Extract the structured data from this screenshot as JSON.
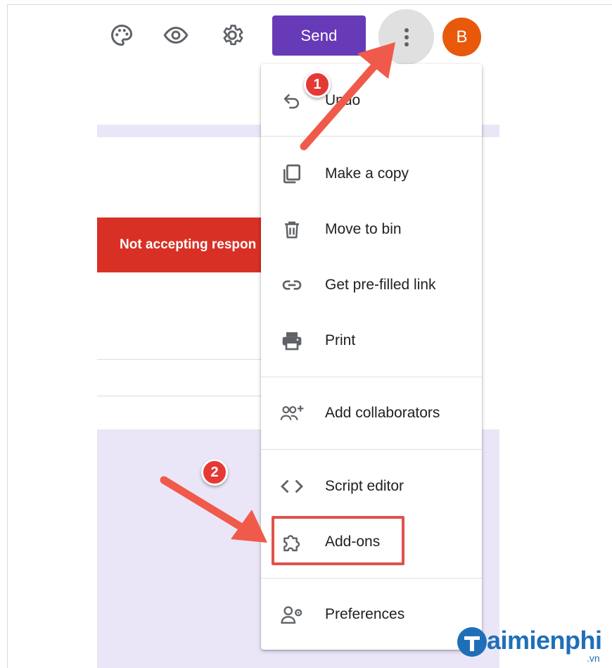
{
  "toolbar": {
    "icons": [
      "palette-icon",
      "eye-icon",
      "gear-icon"
    ],
    "send_label": "Send",
    "more_icon": "more-vert-icon",
    "avatar_letter": "B"
  },
  "form": {
    "status_banner": "Not accepting respon"
  },
  "menu": {
    "items": [
      {
        "label": "Undo",
        "icon": "undo-icon"
      },
      {
        "label": "Make a copy",
        "icon": "copy-icon"
      },
      {
        "label": "Move to bin",
        "icon": "trash-icon"
      },
      {
        "label": "Get pre-filled link",
        "icon": "link-icon"
      },
      {
        "label": "Print",
        "icon": "printer-icon"
      },
      {
        "label": "Add collaborators",
        "icon": "add-people-icon"
      },
      {
        "label": "Script editor",
        "icon": "code-icon"
      },
      {
        "label": "Add-ons",
        "icon": "puzzle-icon"
      },
      {
        "label": "Preferences",
        "icon": "person-settings-icon"
      }
    ]
  },
  "annotations": {
    "step1": "1",
    "step2": "2",
    "arrow_color": "#f05a4a"
  },
  "watermark": {
    "brand": "aimienphi",
    "suffix": ".vn"
  },
  "colors": {
    "send": "#673ab7",
    "avatar": "#e8590c",
    "banner": "#d93025",
    "form_background": "#ebe6f7",
    "highlight": "#e0524d"
  }
}
